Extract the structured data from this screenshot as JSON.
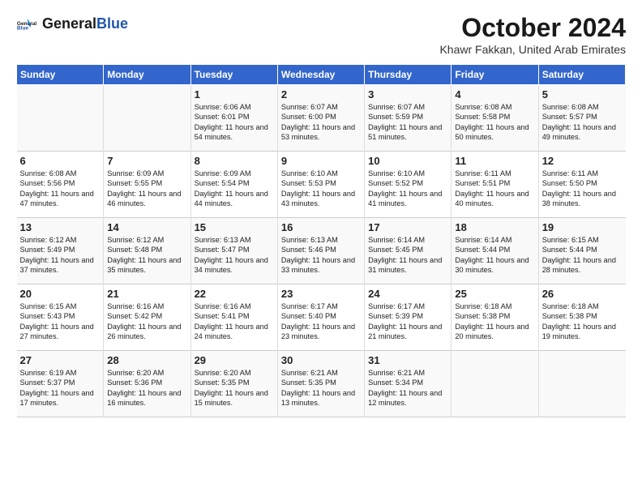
{
  "header": {
    "logo_general": "General",
    "logo_blue": "Blue",
    "month_title": "October 2024",
    "subtitle": "Khawr Fakkan, United Arab Emirates"
  },
  "days_of_week": [
    "Sunday",
    "Monday",
    "Tuesday",
    "Wednesday",
    "Thursday",
    "Friday",
    "Saturday"
  ],
  "weeks": [
    [
      {
        "day": "",
        "text": ""
      },
      {
        "day": "",
        "text": ""
      },
      {
        "day": "1",
        "text": "Sunrise: 6:06 AM\nSunset: 6:01 PM\nDaylight: 11 hours and 54 minutes."
      },
      {
        "day": "2",
        "text": "Sunrise: 6:07 AM\nSunset: 6:00 PM\nDaylight: 11 hours and 53 minutes."
      },
      {
        "day": "3",
        "text": "Sunrise: 6:07 AM\nSunset: 5:59 PM\nDaylight: 11 hours and 51 minutes."
      },
      {
        "day": "4",
        "text": "Sunrise: 6:08 AM\nSunset: 5:58 PM\nDaylight: 11 hours and 50 minutes."
      },
      {
        "day": "5",
        "text": "Sunrise: 6:08 AM\nSunset: 5:57 PM\nDaylight: 11 hours and 49 minutes."
      }
    ],
    [
      {
        "day": "6",
        "text": "Sunrise: 6:08 AM\nSunset: 5:56 PM\nDaylight: 11 hours and 47 minutes."
      },
      {
        "day": "7",
        "text": "Sunrise: 6:09 AM\nSunset: 5:55 PM\nDaylight: 11 hours and 46 minutes."
      },
      {
        "day": "8",
        "text": "Sunrise: 6:09 AM\nSunset: 5:54 PM\nDaylight: 11 hours and 44 minutes."
      },
      {
        "day": "9",
        "text": "Sunrise: 6:10 AM\nSunset: 5:53 PM\nDaylight: 11 hours and 43 minutes."
      },
      {
        "day": "10",
        "text": "Sunrise: 6:10 AM\nSunset: 5:52 PM\nDaylight: 11 hours and 41 minutes."
      },
      {
        "day": "11",
        "text": "Sunrise: 6:11 AM\nSunset: 5:51 PM\nDaylight: 11 hours and 40 minutes."
      },
      {
        "day": "12",
        "text": "Sunrise: 6:11 AM\nSunset: 5:50 PM\nDaylight: 11 hours and 38 minutes."
      }
    ],
    [
      {
        "day": "13",
        "text": "Sunrise: 6:12 AM\nSunset: 5:49 PM\nDaylight: 11 hours and 37 minutes."
      },
      {
        "day": "14",
        "text": "Sunrise: 6:12 AM\nSunset: 5:48 PM\nDaylight: 11 hours and 35 minutes."
      },
      {
        "day": "15",
        "text": "Sunrise: 6:13 AM\nSunset: 5:47 PM\nDaylight: 11 hours and 34 minutes."
      },
      {
        "day": "16",
        "text": "Sunrise: 6:13 AM\nSunset: 5:46 PM\nDaylight: 11 hours and 33 minutes."
      },
      {
        "day": "17",
        "text": "Sunrise: 6:14 AM\nSunset: 5:45 PM\nDaylight: 11 hours and 31 minutes."
      },
      {
        "day": "18",
        "text": "Sunrise: 6:14 AM\nSunset: 5:44 PM\nDaylight: 11 hours and 30 minutes."
      },
      {
        "day": "19",
        "text": "Sunrise: 6:15 AM\nSunset: 5:44 PM\nDaylight: 11 hours and 28 minutes."
      }
    ],
    [
      {
        "day": "20",
        "text": "Sunrise: 6:15 AM\nSunset: 5:43 PM\nDaylight: 11 hours and 27 minutes."
      },
      {
        "day": "21",
        "text": "Sunrise: 6:16 AM\nSunset: 5:42 PM\nDaylight: 11 hours and 26 minutes."
      },
      {
        "day": "22",
        "text": "Sunrise: 6:16 AM\nSunset: 5:41 PM\nDaylight: 11 hours and 24 minutes."
      },
      {
        "day": "23",
        "text": "Sunrise: 6:17 AM\nSunset: 5:40 PM\nDaylight: 11 hours and 23 minutes."
      },
      {
        "day": "24",
        "text": "Sunrise: 6:17 AM\nSunset: 5:39 PM\nDaylight: 11 hours and 21 minutes."
      },
      {
        "day": "25",
        "text": "Sunrise: 6:18 AM\nSunset: 5:38 PM\nDaylight: 11 hours and 20 minutes."
      },
      {
        "day": "26",
        "text": "Sunrise: 6:18 AM\nSunset: 5:38 PM\nDaylight: 11 hours and 19 minutes."
      }
    ],
    [
      {
        "day": "27",
        "text": "Sunrise: 6:19 AM\nSunset: 5:37 PM\nDaylight: 11 hours and 17 minutes."
      },
      {
        "day": "28",
        "text": "Sunrise: 6:20 AM\nSunset: 5:36 PM\nDaylight: 11 hours and 16 minutes."
      },
      {
        "day": "29",
        "text": "Sunrise: 6:20 AM\nSunset: 5:35 PM\nDaylight: 11 hours and 15 minutes."
      },
      {
        "day": "30",
        "text": "Sunrise: 6:21 AM\nSunset: 5:35 PM\nDaylight: 11 hours and 13 minutes."
      },
      {
        "day": "31",
        "text": "Sunrise: 6:21 AM\nSunset: 5:34 PM\nDaylight: 11 hours and 12 minutes."
      },
      {
        "day": "",
        "text": ""
      },
      {
        "day": "",
        "text": ""
      }
    ]
  ]
}
